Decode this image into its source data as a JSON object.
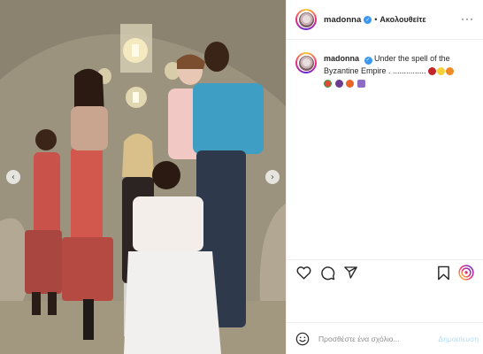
{
  "header": {
    "username": "madonna",
    "separator": "•",
    "follow_label": "Ακολουθείτε",
    "more_label": "···"
  },
  "caption": {
    "username": "madonna",
    "text": "Under the spell of the Byzantine Empire . ...............",
    "emoji_icons": [
      "cherries-emoji",
      "lemon-emoji",
      "tangerine-emoji",
      "watermelon-emoji",
      "eggplant-emoji",
      "tangerine-emoji",
      "cross-emoji"
    ]
  },
  "photo": {
    "prev_label": "‹",
    "next_label": "›"
  },
  "actions": {
    "icons": [
      "heart-icon",
      "comment-icon",
      "share-icon",
      "bookmark-icon",
      "instagram-badge-icon"
    ]
  },
  "comment_box": {
    "placeholder": "Προσθέστε ένα σχόλιο...",
    "post_label": "Δημοσίευση"
  },
  "colors": {
    "verified": "#3897f0",
    "post_disabled": "#b2dffc",
    "border": "#efefef"
  }
}
